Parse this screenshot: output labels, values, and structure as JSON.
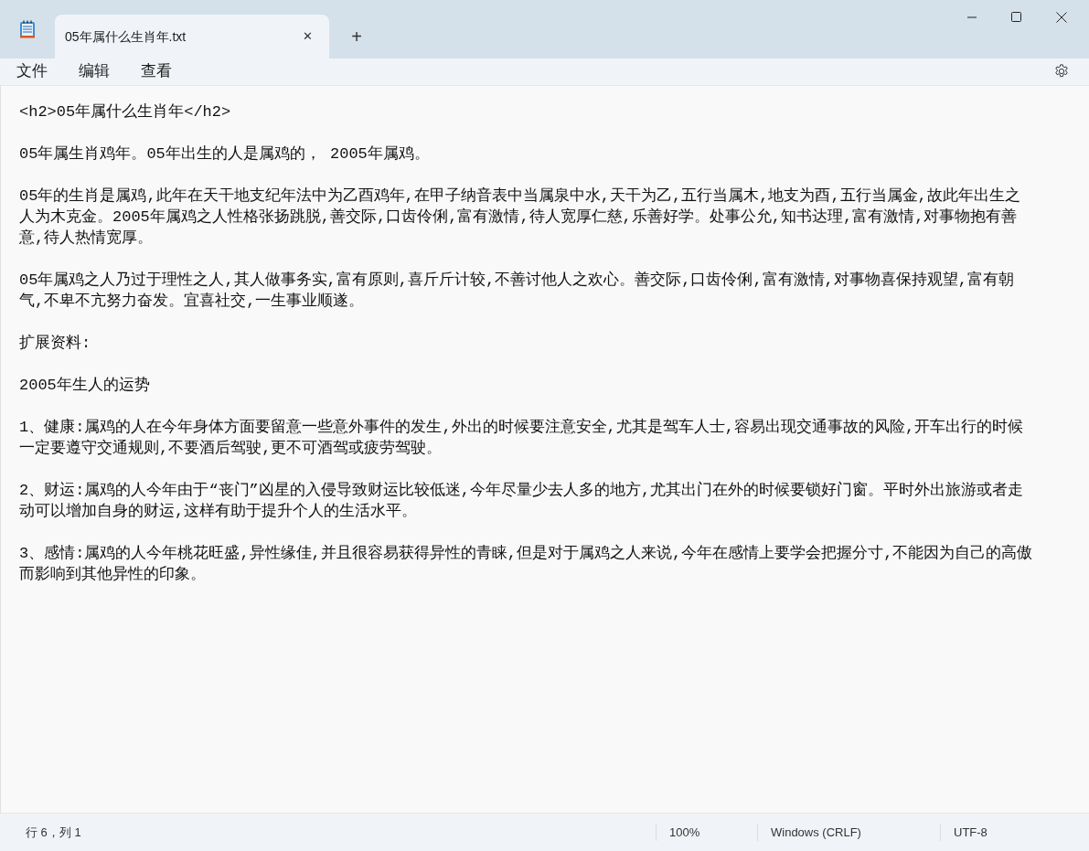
{
  "window": {
    "tab_title": "05年属什么生肖年.txt",
    "tab_close": "✕",
    "new_tab": "+"
  },
  "menu": [
    {
      "label": "文件"
    },
    {
      "label": "编辑"
    },
    {
      "label": "查看"
    }
  ],
  "document": {
    "paragraphs": [
      [
        "<h2>05年属什么生肖年</h2>"
      ],
      [
        "05年属生肖鸡年。05年出生的人是属鸡的， 2005年属鸡。"
      ],
      [
        "05年的生肖是属鸡,此年在天干地支纪年法中为乙酉鸡年,在甲子纳音表中当属泉中水,天干为乙,五行当属木,地支为酉,五行当属金,故此年出生之",
        "人为木克金。2005年属鸡之人性格张扬跳脱,善交际,口齿伶俐,富有激情,待人宽厚仁慈,乐善好学。处事公允,知书达理,富有激情,对事物抱有善",
        "意,待人热情宽厚。"
      ],
      [
        "05年属鸡之人乃过于理性之人,其人做事务实,富有原则,喜斤斤计较,不善讨他人之欢心。善交际,口齿伶俐,富有激情,对事物喜保持观望,富有朝",
        "气,不卑不亢努力奋发。宜喜社交,一生事业顺遂。"
      ],
      [
        "扩展资料:"
      ],
      [
        "2005年生人的运势"
      ],
      [
        "1、健康:属鸡的人在今年身体方面要留意一些意外事件的发生,外出的时候要注意安全,尤其是驾车人士,容易出现交通事故的风险,开车出行的时候",
        "一定要遵守交通规则,不要酒后驾驶,更不可酒驾或疲劳驾驶。"
      ],
      [
        "2、财运:属鸡的人今年由于“丧门”凶星的入侵导致财运比较低迷,今年尽量少去人多的地方,尤其出门在外的时候要锁好门窗。平时外出旅游或者走",
        "动可以增加自身的财运,这样有助于提升个人的生活水平。"
      ],
      [
        "3、感情:属鸡的人今年桃花旺盛,异性缘佳,并且很容易获得异性的青睐,但是对于属鸡之人来说,今年在感情上要学会把握分寸,不能因为自己的高傲",
        "而影响到其他异性的印象。"
      ]
    ]
  },
  "status_bar": {
    "position": "行 6，列 1",
    "zoom": "100%",
    "line_ending": "Windows (CRLF)",
    "encoding": "UTF-8"
  }
}
